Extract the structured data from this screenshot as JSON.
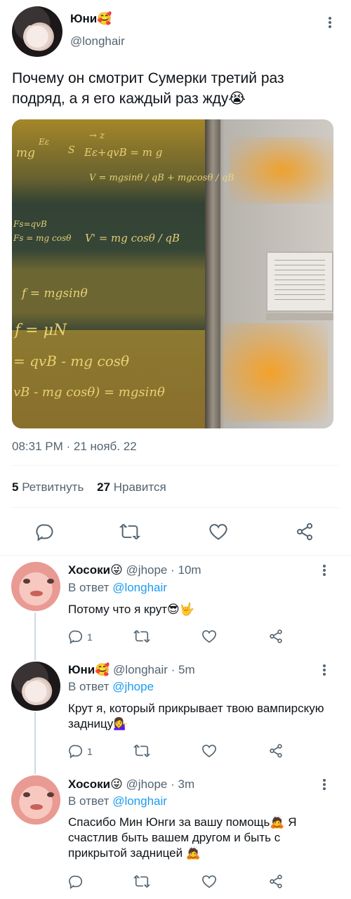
{
  "main_tweet": {
    "name": "Юни🥰",
    "handle": "@longhair",
    "text": "Почему он смотрит Сумерки третий раз подряд, а я его каждый раз жду😭",
    "timestamp": "08:31 PM · 21 нояб. 22",
    "retweets_count": "5",
    "retweets_label": "Ретвитнуть",
    "likes_count": "27",
    "likes_label": "Нравится",
    "photo_chalk": [
      "mg",
      "Eε",
      "S",
      "→ z",
      "Eε+qvB = m g",
      "V = mgsinθ / qB + mgcosθ / qB",
      "Fs=qvB",
      "Fs = mg cosθ",
      "V' = mg cosθ / qB",
      "f = mgsinθ",
      "f = μN",
      "= qvB - mg cosθ",
      "vB - mg cosθ) = mgsinθ"
    ]
  },
  "replies": [
    {
      "name": "Хосоки😜",
      "handle": "@jhope",
      "time": "· 10m",
      "reply_prefix": "В ответ",
      "reply_to": "@longhair",
      "text": "Потому что я крут😎🤟",
      "reply_count": "1"
    },
    {
      "name": "Юни🥰",
      "handle": "@longhair",
      "time": "· 5m",
      "reply_prefix": "В ответ",
      "reply_to": "@jhope",
      "text": "Крут я, который прикрывает твою вампирскую задницу💁‍♀️",
      "reply_count": "1"
    },
    {
      "name": "Хосоки😜",
      "handle": "@jhope",
      "time": "· 3m",
      "reply_prefix": "В ответ",
      "reply_to": "@longhair",
      "text": "Спасибо Мин Юнги за вашу помощь🙇 Я счастлив быть вашем другом и быть с прикрытой задницей 🙇"
    }
  ],
  "colors": {
    "accent": "#1d9bf0",
    "muted": "#536471",
    "text": "#0f1419",
    "divider": "#eff3f4"
  }
}
